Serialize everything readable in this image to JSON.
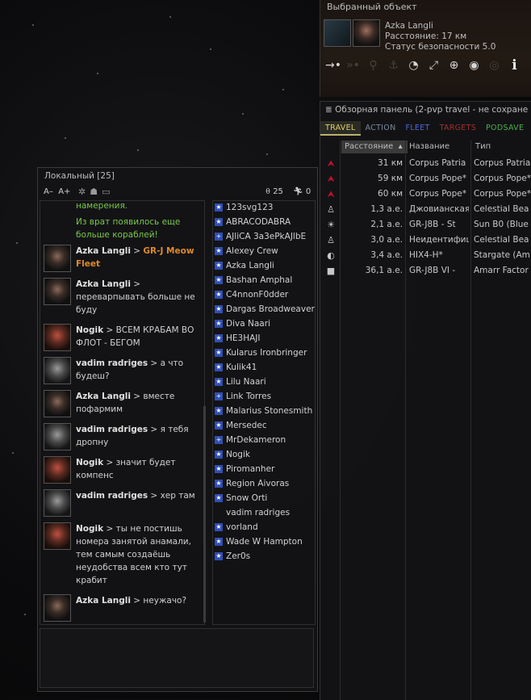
{
  "selected_item": {
    "title": "Выбранный объект",
    "name": "Azka Langli",
    "distance": "Расстояние: 17 км",
    "security": "Статус безопасности 5.0"
  },
  "overview": {
    "header": "Обзорная панель (2-pvp travel - не сохране",
    "tabs": [
      {
        "label": "TRAVEL",
        "color": "#e0d060"
      },
      {
        "label": "ACTION",
        "color": "#7a8aa0"
      },
      {
        "label": "FLEET",
        "color": "#4a6ad0"
      },
      {
        "label": "TARGETS",
        "color": "#a03030"
      },
      {
        "label": "PODSAVE",
        "color": "#4ab04a"
      }
    ],
    "columns": {
      "distance": "Расстояние",
      "name": "Название",
      "type": "Тип"
    },
    "rows": [
      {
        "icon": "hostile-ship-icon",
        "glyph": "⮝",
        "hostile": true,
        "distance": "31 км",
        "name": "Corpus Patria",
        "type": "Corpus Patria"
      },
      {
        "icon": "hostile-ship-icon",
        "glyph": "⮝",
        "hostile": true,
        "distance": "59 км",
        "name": "Corpus Pope*",
        "type": "Corpus Pope*"
      },
      {
        "icon": "hostile-ship-icon",
        "glyph": "⮝",
        "hostile": true,
        "distance": "60 км",
        "name": "Corpus Pope*",
        "type": "Corpus Pope*"
      },
      {
        "icon": "beacon-icon",
        "glyph": "♙",
        "hostile": false,
        "distance": "1,3 а.е.",
        "name": "Джовианская",
        "type": "Celestial Bea"
      },
      {
        "icon": "sun-icon",
        "glyph": "☀",
        "hostile": false,
        "distance": "2,1 а.е.",
        "name": "GR-J8B - St",
        "type": "Sun B0 (Blue"
      },
      {
        "icon": "beacon-icon",
        "glyph": "♙",
        "hostile": false,
        "distance": "3,0 а.е.",
        "name": "Неидентифиц",
        "type": "Celestial Bea"
      },
      {
        "icon": "stargate-icon",
        "glyph": "◐",
        "hostile": false,
        "distance": "3,4 а.е.",
        "name": "HIX4-H*",
        "type": "Stargate (Am"
      },
      {
        "icon": "station-icon",
        "glyph": "■",
        "hostile": false,
        "distance": "36,1 а.е.",
        "name": "GR-J8B VI -",
        "type": "Amarr Factor"
      }
    ]
  },
  "local": {
    "channel": "Локальный [25]",
    "font_small": "A–",
    "font_large": "A+",
    "member_count": "25",
    "hostile_count": "0",
    "messages": [
      {
        "avatar": "",
        "speaker": "",
        "highlight": "",
        "text": "намерения.",
        "green": true,
        "lines": 1
      },
      {
        "avatar": "",
        "speaker": "",
        "highlight": "",
        "text": "Из врат появилось еще больше кораблей!",
        "green": true,
        "lines": 2
      },
      {
        "avatar": "p1",
        "speaker": "Azka Langli",
        "highlight": "GR-J Meow Fleet",
        "text": "",
        "green": false,
        "lines": 2
      },
      {
        "avatar": "p1",
        "speaker": "Azka Langli",
        "highlight": "",
        "text": "переварпывать больше не буду",
        "green": false,
        "lines": 3
      },
      {
        "avatar": "p2",
        "speaker": "Nogik",
        "highlight": "",
        "text": "ВСЕМ КРАБАМ ВО ФЛОТ - БЕГОМ",
        "green": false,
        "lines": 2
      },
      {
        "avatar": "p3",
        "speaker": "vadim radriges",
        "highlight": "",
        "text": "а что будеш?",
        "green": false,
        "lines": 2
      },
      {
        "avatar": "p1",
        "speaker": "Azka Langli",
        "highlight": "",
        "text": "вместе пофармим",
        "green": false,
        "lines": 2
      },
      {
        "avatar": "p3",
        "speaker": "vadim radriges",
        "highlight": "",
        "text": "я тебя дропну",
        "green": false,
        "lines": 2
      },
      {
        "avatar": "p2",
        "speaker": "Nogik",
        "highlight": "",
        "text": "значит будет компенс",
        "green": false,
        "lines": 2
      },
      {
        "avatar": "p3",
        "speaker": "vadim radriges",
        "highlight": "",
        "text": "хер там",
        "green": false,
        "lines": 2
      },
      {
        "avatar": "p2",
        "speaker": "Nogik",
        "highlight": "",
        "text": "ты не постишь номера занятой анамали, тем самым создаёшь неудобства всем кто тут крабит",
        "green": false,
        "lines": 5
      },
      {
        "avatar": "p1",
        "speaker": "Azka Langli",
        "highlight": "",
        "text": "неужачо?",
        "green": false,
        "lines": 2
      }
    ],
    "members": [
      {
        "name": "123svg123",
        "mark": "★"
      },
      {
        "name": "ABRACODABRA",
        "mark": "★"
      },
      {
        "name": "AJliCA 3a3ePkAJlbE",
        "mark": "+"
      },
      {
        "name": "Alexey Crew",
        "mark": "★"
      },
      {
        "name": "Azka Langli",
        "mark": "★"
      },
      {
        "name": "Bashan Amphal",
        "mark": "★"
      },
      {
        "name": "C4nnonF0dder",
        "mark": "★"
      },
      {
        "name": "Dargas Broadweaver",
        "mark": "★"
      },
      {
        "name": "Diva Naari",
        "mark": "★"
      },
      {
        "name": "HE3HAJI",
        "mark": "★"
      },
      {
        "name": "Kularus Ironbringer",
        "mark": "★"
      },
      {
        "name": "Kulik41",
        "mark": "★"
      },
      {
        "name": "Lilu Naari",
        "mark": "★"
      },
      {
        "name": "Link Torres",
        "mark": "+"
      },
      {
        "name": "Malarius Stonesmith",
        "mark": "★"
      },
      {
        "name": "Mersedec",
        "mark": "★"
      },
      {
        "name": "MrDekameron",
        "mark": "+"
      },
      {
        "name": "Nogik",
        "mark": "★"
      },
      {
        "name": "Piromanher",
        "mark": "★"
      },
      {
        "name": "Region Aivoras",
        "mark": "★"
      },
      {
        "name": "Snow Orti",
        "mark": "★"
      },
      {
        "name": "vadim radriges",
        "mark": ""
      },
      {
        "name": "vorland",
        "mark": "★"
      },
      {
        "name": "Wade W Hampton",
        "mark": "★"
      },
      {
        "name": "Zer0s",
        "mark": "★"
      }
    ]
  },
  "colors": {
    "hostile": "#c8102e",
    "highlight": "#e08a2a",
    "system_message": "#7ac84b",
    "standing_blue": "#2f4fb5"
  }
}
